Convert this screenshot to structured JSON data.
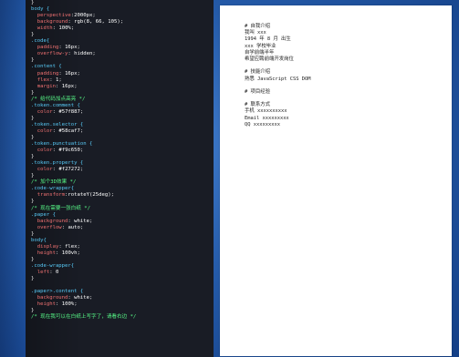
{
  "code_lines": [
    [
      {
        "t": "}",
        "c": "txt"
      }
    ],
    [
      {
        "t": "body {",
        "c": "sel"
      }
    ],
    [
      {
        "t": "  perspective",
        "c": "prop"
      },
      {
        "t": ":",
        "c": "txt"
      },
      {
        "t": "2000px",
        "c": "val"
      },
      {
        "t": ";",
        "c": "txt"
      }
    ],
    [
      {
        "t": "  background",
        "c": "prop"
      },
      {
        "t": ": ",
        "c": "txt"
      },
      {
        "t": "rgb(8, 66, 105)",
        "c": "val"
      },
      {
        "t": ";",
        "c": "txt"
      }
    ],
    [
      {
        "t": "  width",
        "c": "prop"
      },
      {
        "t": ": ",
        "c": "txt"
      },
      {
        "t": "100%",
        "c": "val"
      },
      {
        "t": ";",
        "c": "txt"
      }
    ],
    [
      {
        "t": "}",
        "c": "txt"
      }
    ],
    [
      {
        "t": ".code{",
        "c": "sel"
      }
    ],
    [
      {
        "t": "  padding",
        "c": "prop"
      },
      {
        "t": ": ",
        "c": "txt"
      },
      {
        "t": "16px",
        "c": "val"
      },
      {
        "t": ";",
        "c": "txt"
      }
    ],
    [
      {
        "t": "  overflow-y",
        "c": "prop"
      },
      {
        "t": ": ",
        "c": "txt"
      },
      {
        "t": "hidden",
        "c": "val"
      },
      {
        "t": ";",
        "c": "txt"
      }
    ],
    [
      {
        "t": "}",
        "c": "txt"
      }
    ],
    [
      {
        "t": ".content {",
        "c": "sel"
      }
    ],
    [
      {
        "t": "  padding",
        "c": "prop"
      },
      {
        "t": ": ",
        "c": "txt"
      },
      {
        "t": "16px",
        "c": "val"
      },
      {
        "t": ";",
        "c": "txt"
      }
    ],
    [
      {
        "t": "  flex",
        "c": "prop"
      },
      {
        "t": ": ",
        "c": "txt"
      },
      {
        "t": "1",
        "c": "val"
      },
      {
        "t": ";",
        "c": "txt"
      }
    ],
    [
      {
        "t": "  margin",
        "c": "prop"
      },
      {
        "t": ": ",
        "c": "txt"
      },
      {
        "t": "16px",
        "c": "val"
      },
      {
        "t": ";",
        "c": "txt"
      }
    ],
    [
      {
        "t": "}",
        "c": "txt"
      }
    ],
    [
      {
        "t": "/* 给代码加点高亮 */",
        "c": "cmt"
      }
    ],
    [
      {
        "t": ".token.comment {",
        "c": "sel"
      }
    ],
    [
      {
        "t": "  color",
        "c": "prop"
      },
      {
        "t": ": ",
        "c": "txt"
      },
      {
        "t": "#57f887",
        "c": "val"
      },
      {
        "t": ";",
        "c": "txt"
      }
    ],
    [
      {
        "t": "}",
        "c": "txt"
      }
    ],
    [
      {
        "t": ".token.selector {",
        "c": "sel"
      }
    ],
    [
      {
        "t": "  color",
        "c": "prop"
      },
      {
        "t": ": ",
        "c": "txt"
      },
      {
        "t": "#58caf7",
        "c": "val"
      },
      {
        "t": ";",
        "c": "txt"
      }
    ],
    [
      {
        "t": "}",
        "c": "txt"
      }
    ],
    [
      {
        "t": ".token.punctuation {",
        "c": "sel"
      }
    ],
    [
      {
        "t": "  color",
        "c": "prop"
      },
      {
        "t": ": ",
        "c": "txt"
      },
      {
        "t": "#f9c650",
        "c": "val"
      },
      {
        "t": ";",
        "c": "txt"
      }
    ],
    [
      {
        "t": "}",
        "c": "txt"
      }
    ],
    [
      {
        "t": ".token.property {",
        "c": "sel"
      }
    ],
    [
      {
        "t": "  color",
        "c": "prop"
      },
      {
        "t": ": ",
        "c": "txt"
      },
      {
        "t": "#f27272",
        "c": "val"
      },
      {
        "t": ";",
        "c": "txt"
      }
    ],
    [
      {
        "t": "}",
        "c": "txt"
      }
    ],
    [
      {
        "t": "/* 加个3D效果 */",
        "c": "cmt"
      }
    ],
    [
      {
        "t": ".code-wrapper{",
        "c": "sel"
      }
    ],
    [
      {
        "t": "  transform",
        "c": "prop"
      },
      {
        "t": ":",
        "c": "txt"
      },
      {
        "t": "rotateY(25deg)",
        "c": "val"
      },
      {
        "t": ";",
        "c": "txt"
      }
    ],
    [
      {
        "t": "}",
        "c": "txt"
      }
    ],
    [
      {
        "t": "/* 现在需要一张白纸 */",
        "c": "cmt"
      }
    ],
    [
      {
        "t": ".paper {",
        "c": "sel"
      }
    ],
    [
      {
        "t": "  background",
        "c": "prop"
      },
      {
        "t": ": ",
        "c": "txt"
      },
      {
        "t": "white",
        "c": "val"
      },
      {
        "t": ";",
        "c": "txt"
      }
    ],
    [
      {
        "t": "  overflow",
        "c": "prop"
      },
      {
        "t": ": ",
        "c": "txt"
      },
      {
        "t": "auto",
        "c": "val"
      },
      {
        "t": ";",
        "c": "txt"
      }
    ],
    [
      {
        "t": "}",
        "c": "txt"
      }
    ],
    [
      {
        "t": "body{",
        "c": "sel"
      }
    ],
    [
      {
        "t": "  display",
        "c": "prop"
      },
      {
        "t": ": ",
        "c": "txt"
      },
      {
        "t": "flex",
        "c": "val"
      },
      {
        "t": ";",
        "c": "txt"
      }
    ],
    [
      {
        "t": "  height",
        "c": "prop"
      },
      {
        "t": ": ",
        "c": "txt"
      },
      {
        "t": "100vh",
        "c": "val"
      },
      {
        "t": ";",
        "c": "txt"
      }
    ],
    [
      {
        "t": "}",
        "c": "txt"
      }
    ],
    [
      {
        "t": ".code-wrapper{",
        "c": "sel"
      }
    ],
    [
      {
        "t": "  left",
        "c": "prop"
      },
      {
        "t": ": ",
        "c": "txt"
      },
      {
        "t": "0",
        "c": "val"
      }
    ],
    [
      {
        "t": "}",
        "c": "txt"
      }
    ],
    [
      {
        "t": "",
        "c": "txt"
      }
    ],
    [
      {
        "t": ".paper>.content {",
        "c": "sel"
      }
    ],
    [
      {
        "t": "  background",
        "c": "prop"
      },
      {
        "t": ": ",
        "c": "txt"
      },
      {
        "t": "white",
        "c": "val"
      },
      {
        "t": ";",
        "c": "txt"
      }
    ],
    [
      {
        "t": "  height",
        "c": "prop"
      },
      {
        "t": ": ",
        "c": "txt"
      },
      {
        "t": "100%",
        "c": "val"
      },
      {
        "t": ";",
        "c": "txt"
      }
    ],
    [
      {
        "t": "}",
        "c": "txt"
      }
    ],
    [
      {
        "t": "/* 现在我可以在白纸上写字了，请看右边 */",
        "c": "cmt"
      }
    ]
  ],
  "paper_lines": [
    "# 自我介绍",
    "我叫 xxx",
    "1994 年 8 月 出生",
    "xxx 学校毕业",
    "自学前端半年",
    "希望应聘前端开发岗位",
    "",
    "# 技能介绍",
    "熟悉 JavaScript CSS DOM",
    "",
    "# 项目经验",
    "",
    "# 联系方式",
    "手机 xxxxxxxxxx",
    "Email xxxxxxxxx",
    "QQ xxxxxxxxx"
  ]
}
